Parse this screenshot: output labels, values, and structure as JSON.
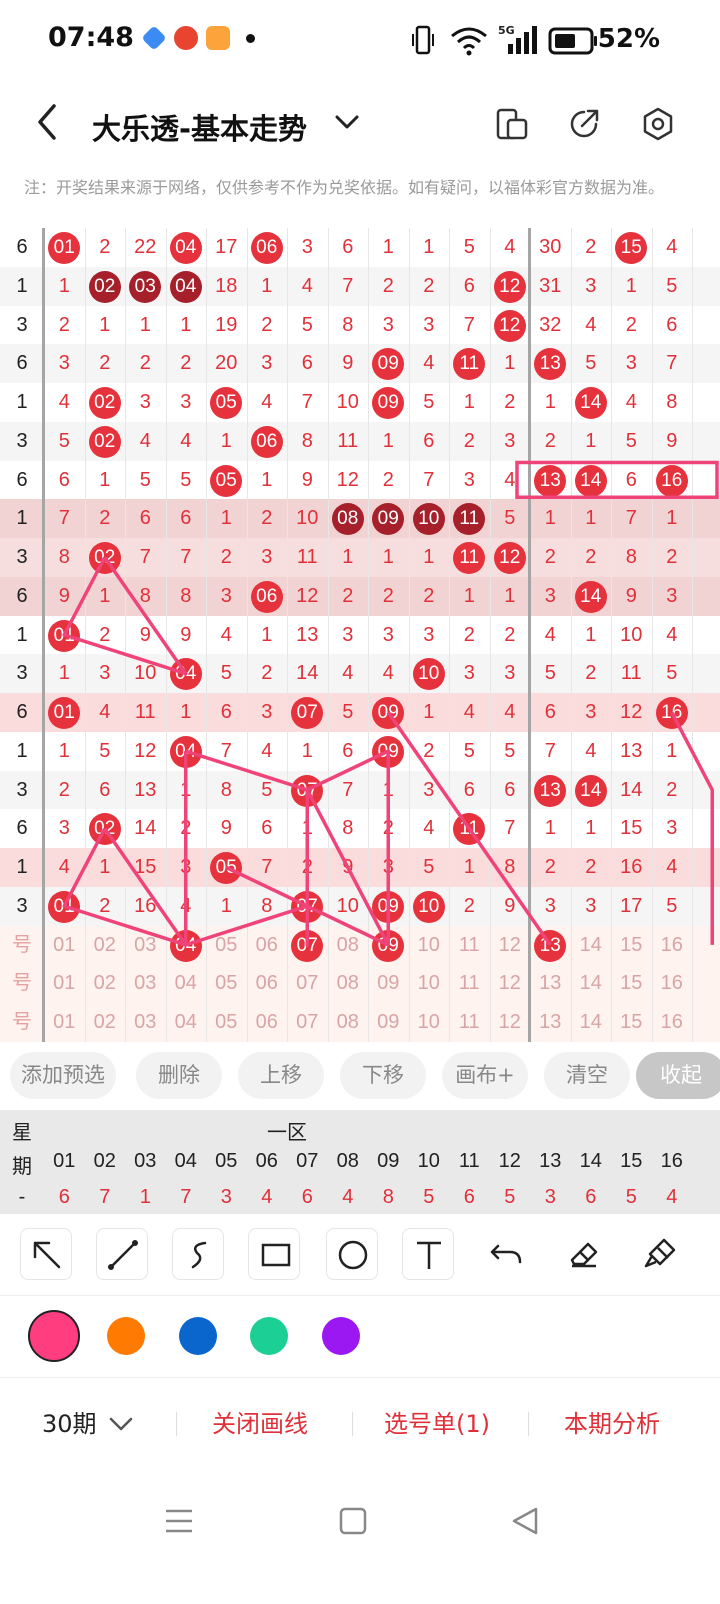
{
  "status_bar": {
    "time": "07:48",
    "battery": "52%",
    "network": "5G"
  },
  "nav": {
    "title": "大乐透-基本走势"
  },
  "notice": "注：开奖结果来源于网络，仅供参考不作为兑奖依据。如有疑问，以福体彩官方数据为准。",
  "grid": {
    "rows": [
      {
        "w": "6",
        "c": [
          [
            "01",
            "r"
          ],
          "2",
          "22",
          [
            "04",
            "r"
          ],
          "17",
          [
            "06",
            "r"
          ],
          "3",
          "6",
          "1",
          "1",
          "5",
          "4",
          "30",
          "2",
          [
            "15",
            "r"
          ],
          "4"
        ]
      },
      {
        "w": "1",
        "c": [
          "1",
          [
            "02",
            "d"
          ],
          [
            "03",
            "d"
          ],
          [
            "04",
            "d"
          ],
          "18",
          "1",
          "4",
          "7",
          "2",
          "2",
          "6",
          [
            "12",
            "r"
          ],
          "31",
          "3",
          "1",
          "5"
        ]
      },
      {
        "w": "3",
        "c": [
          "2",
          "1",
          "1",
          "1",
          "19",
          "2",
          "5",
          "8",
          "3",
          "3",
          "7",
          [
            "12",
            "r"
          ],
          "32",
          "4",
          "2",
          "6"
        ]
      },
      {
        "w": "6",
        "c": [
          "3",
          "2",
          "2",
          "2",
          "20",
          "3",
          "6",
          "9",
          [
            "09",
            "r"
          ],
          "4",
          [
            "11",
            "r"
          ],
          "1",
          [
            "13",
            "r"
          ],
          "5",
          "3",
          "7"
        ]
      },
      {
        "w": "1",
        "c": [
          "4",
          [
            "02",
            "r"
          ],
          "3",
          "3",
          [
            "05",
            "r"
          ],
          "4",
          "7",
          "10",
          [
            "09",
            "r"
          ],
          "5",
          "1",
          "2",
          "1",
          [
            "14",
            "r"
          ],
          "4",
          "8"
        ]
      },
      {
        "w": "3",
        "c": [
          "5",
          [
            "02",
            "r"
          ],
          "4",
          "4",
          "1",
          [
            "06",
            "r"
          ],
          "8",
          "11",
          "1",
          "6",
          "2",
          "3",
          "2",
          "1",
          "5",
          "9"
        ]
      },
      {
        "w": "6",
        "c": [
          "6",
          "1",
          "5",
          "5",
          [
            "05",
            "r"
          ],
          "1",
          "9",
          "12",
          "2",
          "7",
          "3",
          "4",
          [
            "13",
            "r"
          ],
          [
            "14",
            "r"
          ],
          "6",
          [
            "16",
            "r"
          ]
        ]
      },
      {
        "w": "1",
        "c": [
          "7",
          "2",
          "6",
          "6",
          "1",
          "2",
          "10",
          [
            "08",
            "d"
          ],
          [
            "09",
            "d"
          ],
          [
            "10",
            "d"
          ],
          [
            "11",
            "d"
          ],
          "5",
          "1",
          "1",
          "7",
          "1"
        ]
      },
      {
        "w": "3",
        "c": [
          "8",
          [
            "02",
            "r"
          ],
          "7",
          "7",
          "2",
          "3",
          "11",
          "1",
          "1",
          "1",
          [
            "11",
            "r"
          ],
          [
            "12",
            "r"
          ],
          "2",
          "2",
          "8",
          "2"
        ]
      },
      {
        "w": "6",
        "c": [
          "9",
          "1",
          "8",
          "8",
          "3",
          [
            "06",
            "r"
          ],
          "12",
          "2",
          "2",
          "2",
          "1",
          "1",
          "3",
          [
            "14",
            "r"
          ],
          "9",
          "3"
        ]
      },
      {
        "w": "1",
        "c": [
          [
            "01",
            "r"
          ],
          "2",
          "9",
          "9",
          "4",
          "1",
          "13",
          "3",
          "3",
          "3",
          "2",
          "2",
          "4",
          "1",
          "10",
          "4"
        ]
      },
      {
        "w": "3",
        "c": [
          "1",
          "3",
          "10",
          [
            "04",
            "r"
          ],
          "5",
          "2",
          "14",
          "4",
          "4",
          [
            "10",
            "r"
          ],
          "3",
          "3",
          "5",
          "2",
          "11",
          "5"
        ]
      },
      {
        "w": "6",
        "c": [
          [
            "01",
            "r"
          ],
          "4",
          "11",
          "1",
          "6",
          "3",
          [
            "07",
            "r"
          ],
          "5",
          [
            "09",
            "r"
          ],
          "1",
          "4",
          "4",
          "6",
          "3",
          "12",
          [
            "16",
            "r"
          ]
        ]
      },
      {
        "w": "1",
        "c": [
          "1",
          "5",
          "12",
          [
            "04",
            "r"
          ],
          "7",
          "4",
          "1",
          "6",
          [
            "09",
            "r"
          ],
          "2",
          "5",
          "5",
          "7",
          "4",
          "13",
          "1"
        ]
      },
      {
        "w": "3",
        "c": [
          "2",
          "6",
          "13",
          "1",
          "8",
          "5",
          [
            "07",
            "r"
          ],
          "7",
          "1",
          "3",
          "6",
          "6",
          [
            "13",
            "r"
          ],
          [
            "14",
            "r"
          ],
          "14",
          "2"
        ]
      },
      {
        "w": "6",
        "c": [
          "3",
          [
            "02",
            "r"
          ],
          "14",
          "2",
          "9",
          "6",
          "1",
          "8",
          "2",
          "4",
          [
            "11",
            "r"
          ],
          "7",
          "1",
          "1",
          "15",
          "3"
        ]
      },
      {
        "w": "1",
        "c": [
          "4",
          "1",
          "15",
          "3",
          [
            "05",
            "r"
          ],
          "7",
          "2",
          "9",
          "3",
          "5",
          "1",
          "8",
          "2",
          "2",
          "16",
          "4"
        ]
      },
      {
        "w": "3",
        "c": [
          [
            "01",
            "r"
          ],
          "2",
          "16",
          "4",
          "1",
          "8",
          [
            "07",
            "r"
          ],
          "10",
          [
            "09",
            "r"
          ],
          [
            "10",
            "r"
          ],
          "2",
          "9",
          "3",
          "3",
          "17",
          "5"
        ]
      },
      {
        "w": "号",
        "ref": true,
        "c": [
          "01",
          "02",
          "03",
          [
            "04",
            "r"
          ],
          "05",
          "06",
          [
            "07",
            "r"
          ],
          "08",
          [
            "09",
            "r"
          ],
          "10",
          "11",
          "12",
          [
            "13",
            "r"
          ],
          "14",
          "15",
          "16"
        ]
      },
      {
        "w": "号",
        "ref": true,
        "c": [
          "01",
          "02",
          "03",
          "04",
          "05",
          "06",
          "07",
          "08",
          "09",
          "10",
          "11",
          "12",
          "13",
          "14",
          "15",
          "16"
        ]
      },
      {
        "w": "号",
        "ref": true,
        "c": [
          "01",
          "02",
          "03",
          "04",
          "05",
          "06",
          "07",
          "08",
          "09",
          "10",
          "11",
          "12",
          "13",
          "14",
          "15",
          "16"
        ]
      }
    ]
  },
  "buttons": [
    "添加预选",
    "删除",
    "上移",
    "下移",
    "画布+",
    "清空",
    "收起"
  ],
  "summary": {
    "label_top": "星",
    "label_bottom": "期",
    "zone": "一区",
    "numbers": [
      "01",
      "02",
      "03",
      "04",
      "05",
      "06",
      "07",
      "08",
      "09",
      "10",
      "11",
      "12",
      "13",
      "14",
      "15",
      "16"
    ],
    "values": [
      "6",
      "7",
      "1",
      "7",
      "3",
      "4",
      "6",
      "4",
      "8",
      "5",
      "6",
      "5",
      "3",
      "6",
      "5",
      "4"
    ],
    "first": "-"
  },
  "tools": [
    "arrow-icon",
    "line-icon",
    "freehand-icon",
    "rectangle-icon",
    "circle-icon",
    "text-icon",
    "undo-icon",
    "eraser-icon",
    "clear-brush-icon"
  ],
  "colors": [
    "#ff3d7f",
    "#ff7a00",
    "#0a66cc",
    "#1ccf94",
    "#9b18f2"
  ],
  "actions": {
    "period": "30期",
    "close_draw": "关闭画线",
    "selection": "选号单(1)",
    "analysis": "本期分析"
  }
}
